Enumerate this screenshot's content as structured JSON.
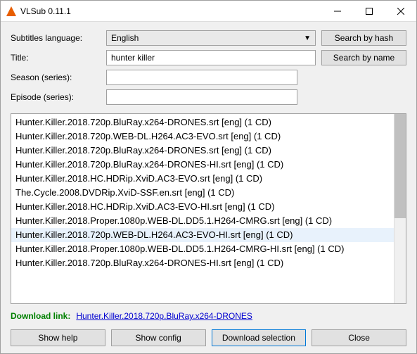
{
  "window": {
    "title": "VLSub 0.11.1"
  },
  "form": {
    "lang_label": "Subtitles language:",
    "lang_value": "English",
    "title_label": "Title:",
    "title_value": "hunter killer",
    "season_label": "Season (series):",
    "season_value": "",
    "episode_label": "Episode (series):",
    "episode_value": ""
  },
  "buttons": {
    "search_hash": "Search by hash",
    "search_name": "Search by name",
    "show_help": "Show help",
    "show_config": "Show config",
    "download_selection": "Download selection",
    "close": "Close"
  },
  "download": {
    "label": "Download link:",
    "link_text": "Hunter.Killer.2018.720p.BluRay.x264-DRONES"
  },
  "results": [
    {
      "text": "Hunter.Killer.2018.720p.BluRay.x264-DRONES.srt [eng] (1 CD)",
      "selected": false
    },
    {
      "text": "Hunter.Killer.2018.720p.WEB-DL.H264.AC3-EVO.srt [eng] (1 CD)",
      "selected": false
    },
    {
      "text": "Hunter.Killer.2018.720p.BluRay.x264-DRONES.srt [eng] (1 CD)",
      "selected": false
    },
    {
      "text": "Hunter.Killer.2018.720p.BluRay.x264-DRONES-HI.srt [eng] (1 CD)",
      "selected": false
    },
    {
      "text": "Hunter.Killer.2018.HC.HDRip.XviD.AC3-EVO.srt [eng] (1 CD)",
      "selected": false
    },
    {
      "text": "The.Cycle.2008.DVDRip.XviD-SSF.en.srt [eng] (1 CD)",
      "selected": false
    },
    {
      "text": "Hunter.Killer.2018.HC.HDRip.XviD.AC3-EVO-HI.srt [eng] (1 CD)",
      "selected": false
    },
    {
      "text": "Hunter.Killer.2018.Proper.1080p.WEB-DL.DD5.1.H264-CMRG.srt [eng] (1 CD)",
      "selected": false
    },
    {
      "text": "Hunter.Killer.2018.720p.WEB-DL.H264.AC3-EVO-HI.srt [eng] (1 CD)",
      "selected": true
    },
    {
      "text": "Hunter.Killer.2018.Proper.1080p.WEB-DL.DD5.1.H264-CMRG-HI.srt [eng] (1 CD)",
      "selected": false
    },
    {
      "text": "Hunter.Killer.2018.720p.BluRay.x264-DRONES-HI.srt [eng] (1 CD)",
      "selected": false
    }
  ]
}
